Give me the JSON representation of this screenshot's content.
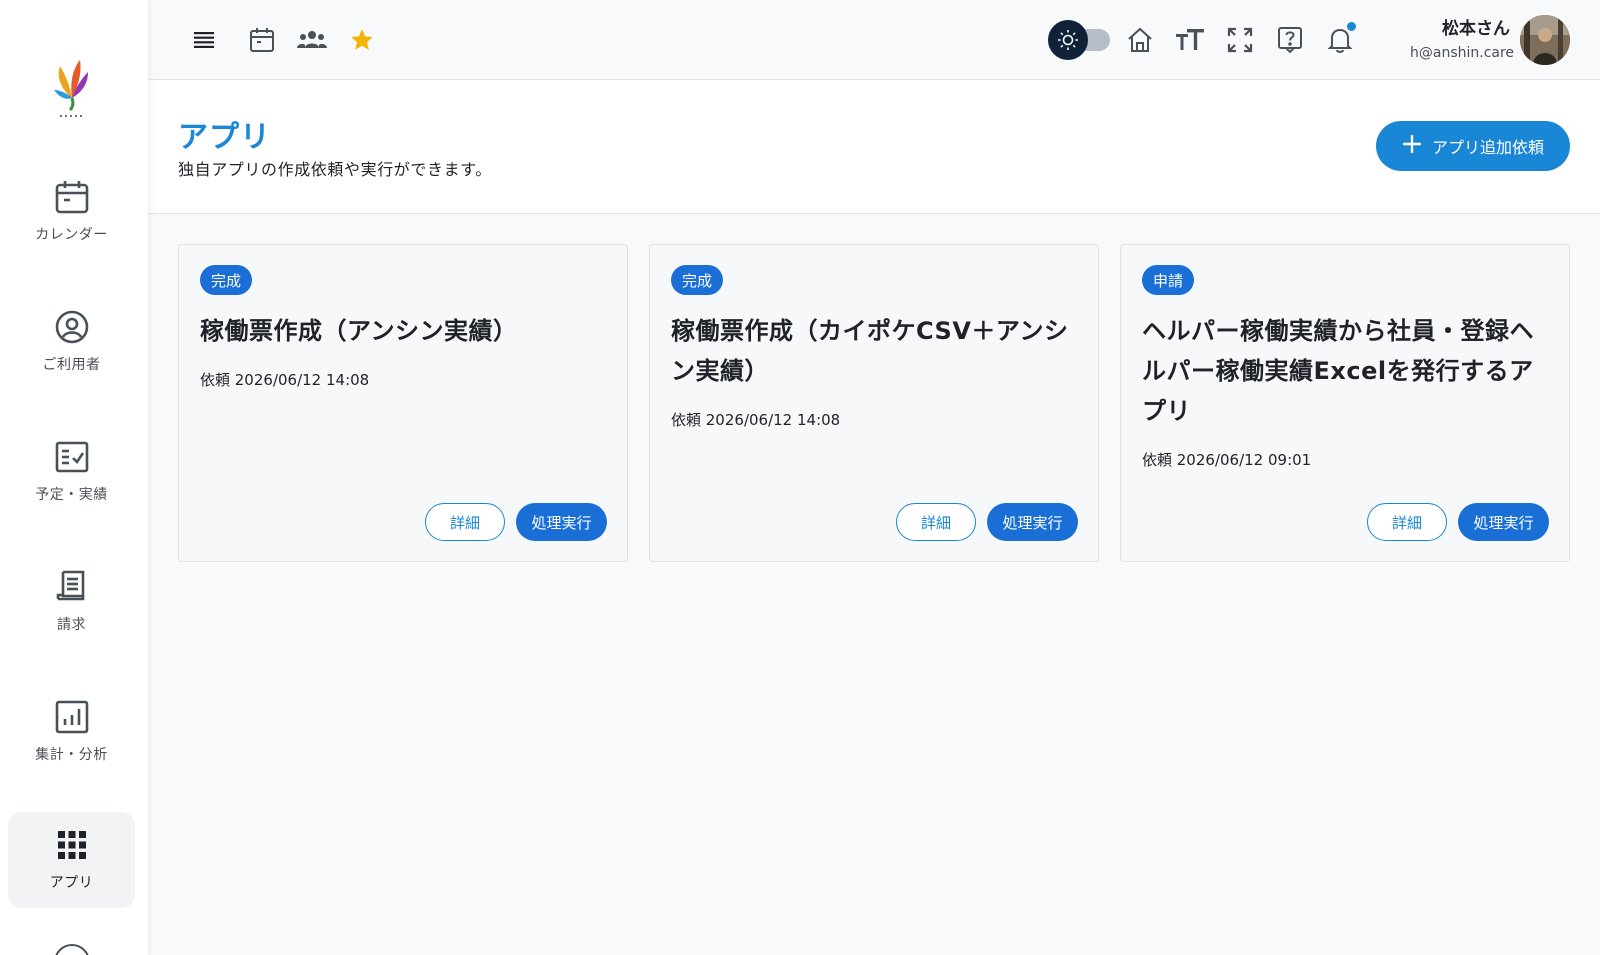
{
  "sidebar": {
    "items": [
      {
        "label": "カレンダー",
        "icon": "calendar-icon"
      },
      {
        "label": "ご利用者",
        "icon": "user-circle-icon"
      },
      {
        "label": "予定・実績",
        "icon": "checklist-icon"
      },
      {
        "label": "請求",
        "icon": "receipt-icon"
      },
      {
        "label": "集計・分析",
        "icon": "bar-chart-icon"
      },
      {
        "label": "アプリ",
        "icon": "apps-grid-icon",
        "active": true
      }
    ]
  },
  "header": {
    "icons": [
      "menu-icon",
      "calendar-icon",
      "group-icon",
      "star-icon",
      "theme-toggle",
      "home-icon",
      "font-size-icon",
      "fullscreen-icon",
      "help-icon",
      "bell-icon"
    ],
    "user": {
      "name": "松本さん",
      "email": "h@anshin.care"
    }
  },
  "page": {
    "title": "アプリ",
    "subtitle": "独自アプリの作成依頼や実行ができます。",
    "add_button_label": "アプリ追加依頼"
  },
  "cards": [
    {
      "status": "完成",
      "title": "稼働票作成（アンシン実績）",
      "date": "依頼 2026/06/12 14:08",
      "detail_label": "詳細",
      "run_label": "処理実行"
    },
    {
      "status": "完成",
      "title": "稼働票作成（カイポケCSV＋アンシン実績）",
      "date": "依頼 2026/06/12 14:08",
      "detail_label": "詳細",
      "run_label": "処理実行"
    },
    {
      "status": "申請",
      "title": "ヘルパー稼働実績から社員・登録ヘルパー稼働実績Excelを発行するアプリ",
      "date": "依頼 2026/06/12 09:01",
      "detail_label": "詳細",
      "run_label": "処理実行"
    }
  ],
  "colors": {
    "accent": "#1a87d6",
    "badge": "#1a6fd6",
    "star": "#f5b400",
    "notif": "#1a87d6"
  }
}
